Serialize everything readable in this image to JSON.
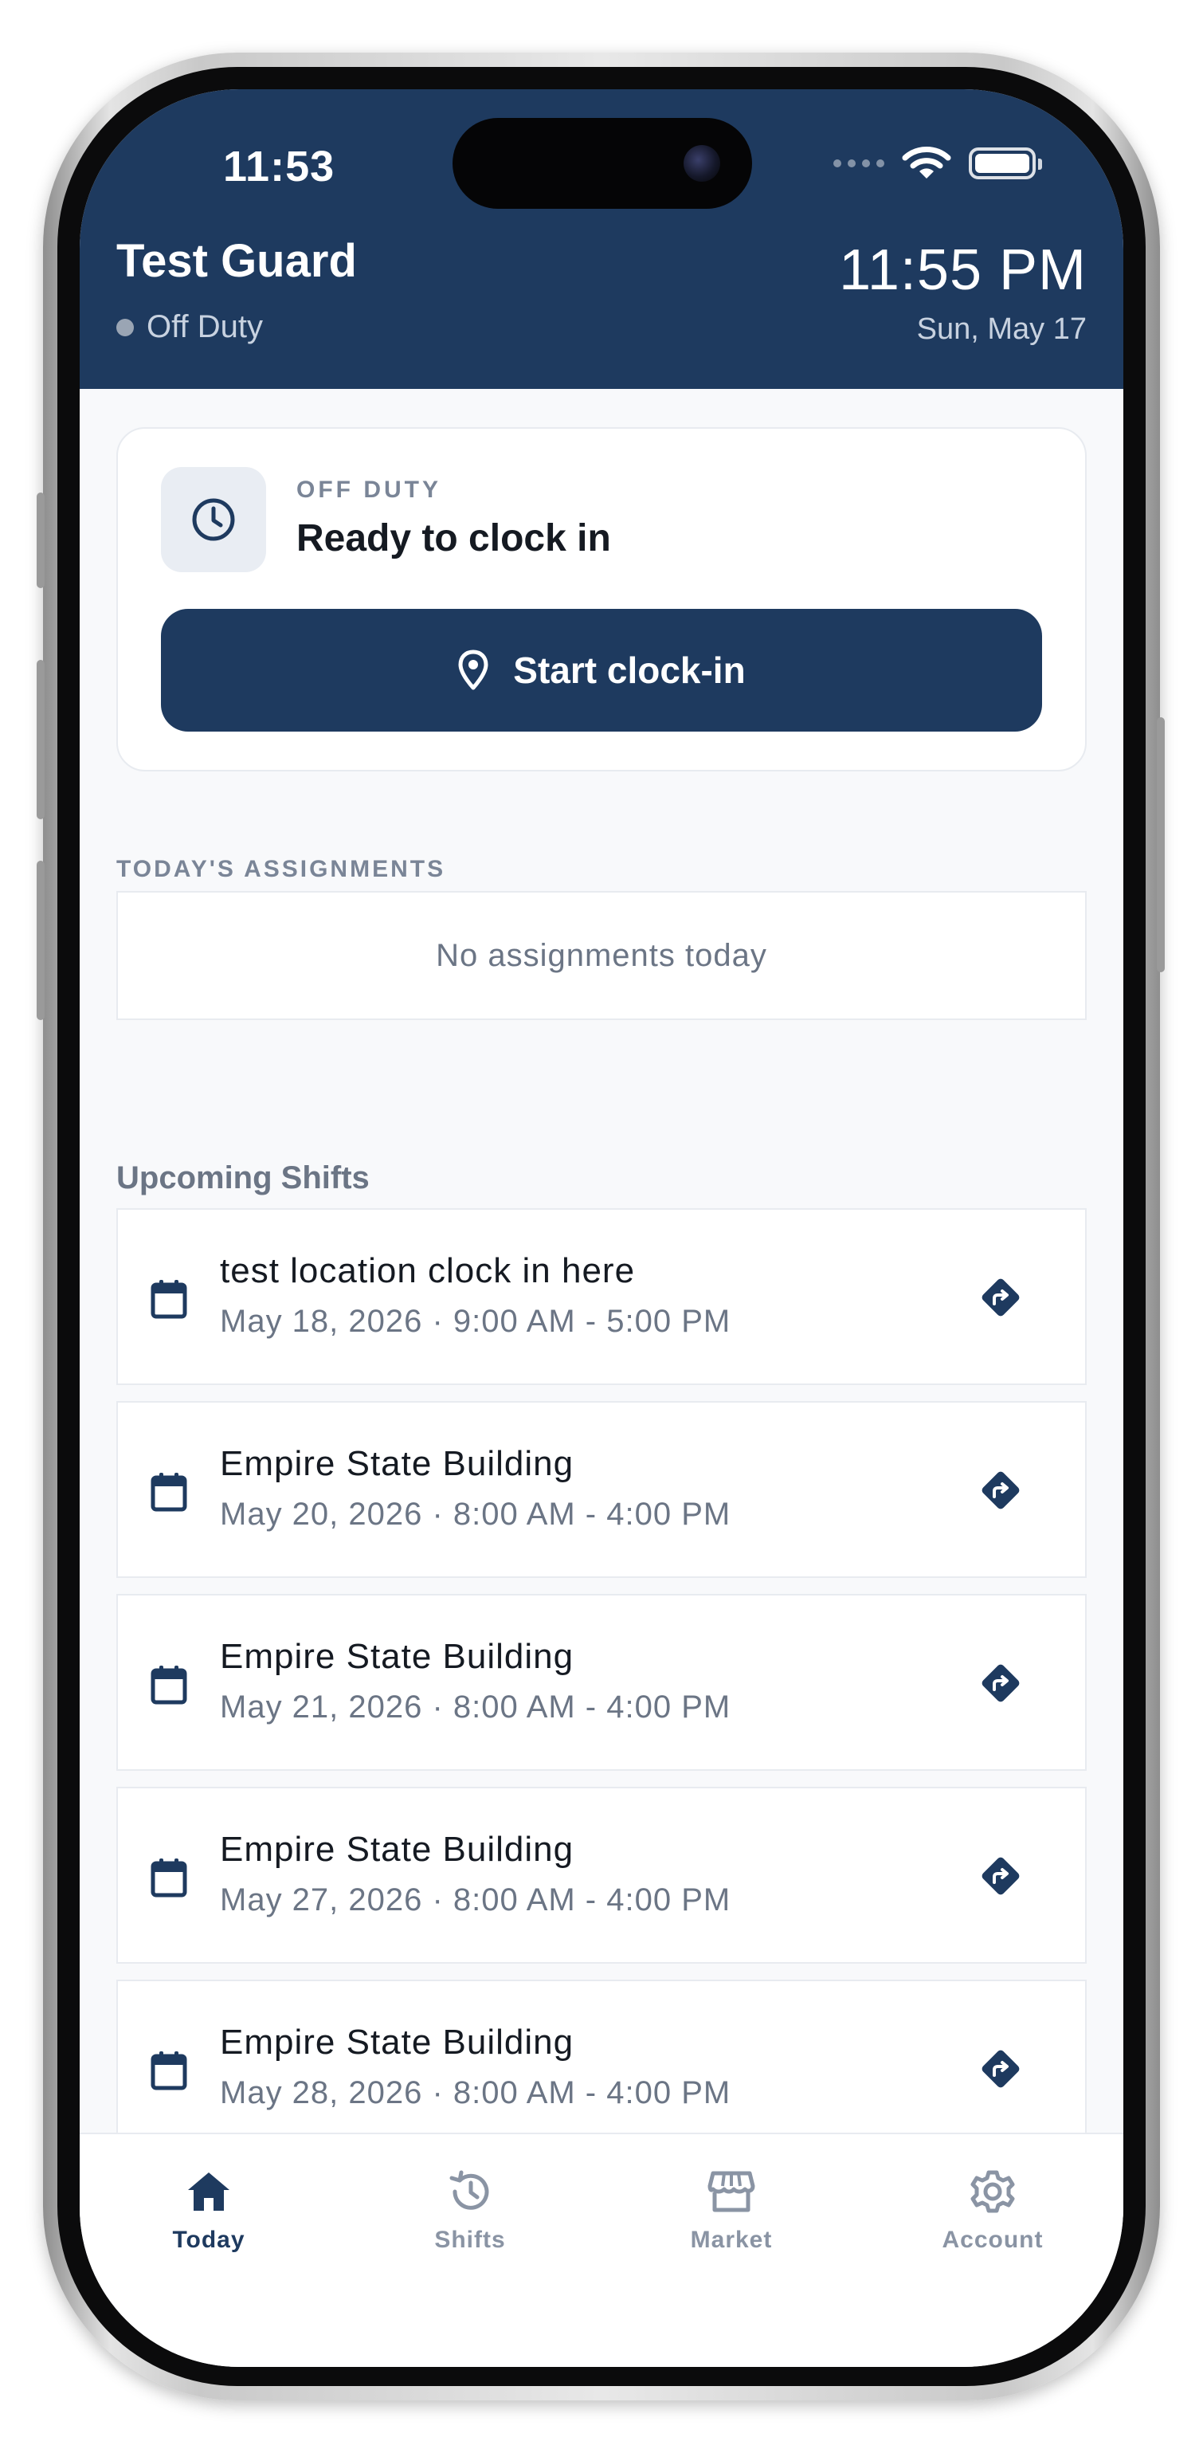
{
  "status_bar": {
    "time": "11:53"
  },
  "header": {
    "guard_name": "Test Guard",
    "duty_status": "Off Duty",
    "current_time": "11:55 PM",
    "current_date": "Sun, May 17"
  },
  "clock_card": {
    "status_label": "OFF DUTY",
    "status_title": "Ready to clock in",
    "start_button": "Start clock-in"
  },
  "assignments": {
    "section_label": "TODAY'S ASSIGNMENTS",
    "empty_text": "No assignments today"
  },
  "upcoming": {
    "title": "Upcoming Shifts",
    "shifts": [
      {
        "location": "test location clock in here",
        "time": "May 18, 2026 · 9:00 AM - 5:00 PM"
      },
      {
        "location": "Empire State Building",
        "time": "May 20, 2026 · 8:00 AM - 4:00 PM"
      },
      {
        "location": "Empire State Building",
        "time": "May 21, 2026 · 8:00 AM - 4:00 PM"
      },
      {
        "location": "Empire State Building",
        "time": "May 27, 2026 · 8:00 AM - 4:00 PM"
      },
      {
        "location": "Empire State Building",
        "time": "May 28, 2026 · 8:00 AM - 4:00 PM"
      }
    ]
  },
  "tabbar": {
    "tabs": [
      {
        "label": "Today",
        "icon": "home-icon",
        "active": true
      },
      {
        "label": "Shifts",
        "icon": "history-icon",
        "active": false
      },
      {
        "label": "Market",
        "icon": "store-icon",
        "active": false
      },
      {
        "label": "Account",
        "icon": "gear-icon",
        "active": false
      }
    ]
  },
  "colors": {
    "brand_navy": "#1e3a5f",
    "background": "#f8f9fb",
    "muted_text": "#6b7585",
    "inactive_tab": "#8a94a4"
  }
}
